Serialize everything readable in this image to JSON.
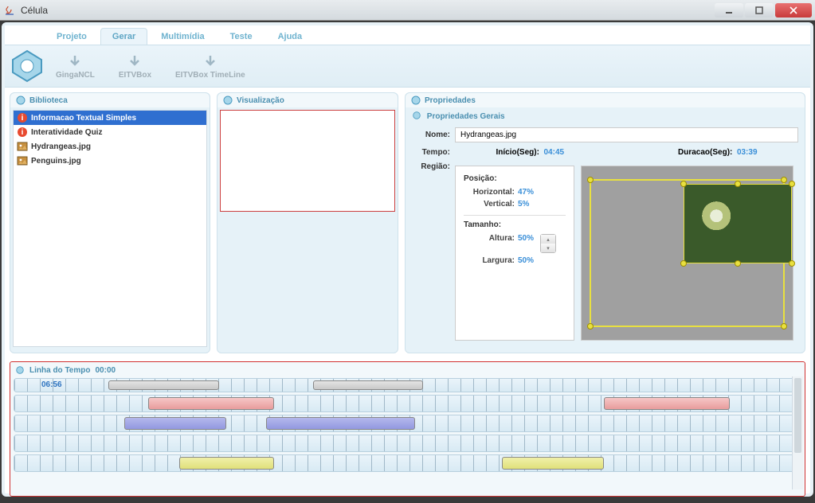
{
  "window": {
    "title": "Célula"
  },
  "menu": {
    "items": [
      "Projeto",
      "Gerar",
      "Multimídia",
      "Teste",
      "Ajuda"
    ],
    "active": 1
  },
  "toolbar": {
    "items": [
      "GingaNCL",
      "EITVBox",
      "EITVBox TimeLine"
    ]
  },
  "panels": {
    "biblio": {
      "title": "Biblioteca",
      "items": [
        {
          "label": "Informacao Textual Simples",
          "type": "i",
          "selected": true
        },
        {
          "label": "Interatividade Quiz",
          "type": "i",
          "selected": false
        },
        {
          "label": "Hydrangeas.jpg",
          "type": "img",
          "selected": false
        },
        {
          "label": "Penguins.jpg",
          "type": "img",
          "selected": false
        }
      ]
    },
    "visual": {
      "title": "Visualização"
    },
    "props": {
      "title": "Propriedades",
      "subtitle": "Propriedades Gerais",
      "name_label": "Nome:",
      "name_value": "Hydrangeas.jpg",
      "tempo_label": "Tempo:",
      "inicio_label": "Início(Seg):",
      "inicio_value": "04:45",
      "duracao_label": "Duracao(Seg):",
      "duracao_value": "03:39",
      "regiao_label": "Região:",
      "posicao_label": "Posição:",
      "horizontal_label": "Horizontal:",
      "horizontal_value": "47%",
      "vertical_label": "Vertical:",
      "vertical_value": "5%",
      "tamanho_label": "Tamanho:",
      "altura_label": "Altura:",
      "altura_value": "50%",
      "largura_label": "Largura:",
      "largura_value": "50%"
    }
  },
  "timeline": {
    "title": "Linha do Tempo ",
    "total": "00:00",
    "current": "06:56",
    "tracks": [
      {
        "clips": [
          {
            "start": 12,
            "w": 14,
            "c": "gray"
          },
          {
            "start": 38,
            "w": 14,
            "c": "gray"
          }
        ]
      },
      {
        "clips": [
          {
            "start": 17,
            "w": 16,
            "c": "red"
          },
          {
            "start": 75,
            "w": 16,
            "c": "red"
          }
        ]
      },
      {
        "clips": [
          {
            "start": 14,
            "w": 13,
            "c": "blue"
          },
          {
            "start": 32,
            "w": 19,
            "c": "blue"
          }
        ]
      },
      {
        "clips": []
      },
      {
        "clips": [
          {
            "start": 21,
            "w": 12,
            "c": "yellow"
          },
          {
            "start": 62,
            "w": 13,
            "c": "yellow"
          }
        ]
      }
    ]
  }
}
